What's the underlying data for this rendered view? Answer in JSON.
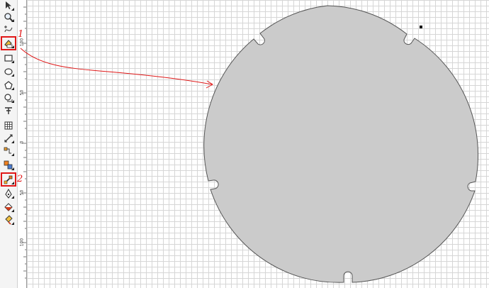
{
  "toolbox": {
    "tools": [
      {
        "name": "pick-tool",
        "icon": "pointer-icon"
      },
      {
        "name": "zoom-tool",
        "icon": "magnifier-icon"
      },
      {
        "name": "freehand-tool",
        "icon": "freehand-icon"
      },
      {
        "name": "smart-fill-tool",
        "icon": "smart-fill-icon"
      },
      {
        "name": "rectangle-tool",
        "icon": "rectangle-icon"
      },
      {
        "name": "ellipse-tool",
        "icon": "ellipse-icon"
      },
      {
        "name": "polygon-tool",
        "icon": "polygon-icon"
      },
      {
        "name": "basic-shapes-tool",
        "icon": "basic-shapes-icon"
      },
      {
        "name": "text-tool",
        "icon": "text-icon"
      },
      {
        "name": "table-tool",
        "icon": "table-icon"
      },
      {
        "name": "dimension-tool",
        "icon": "dimension-icon"
      },
      {
        "name": "connector-tool",
        "icon": "connector-icon"
      },
      {
        "name": "blend-tool",
        "icon": "blend-icon"
      },
      {
        "name": "eyedropper-tool",
        "icon": "eyedropper-icon"
      },
      {
        "name": "outline-pen-tool",
        "icon": "outline-pen-icon"
      },
      {
        "name": "fill-tool",
        "icon": "fill-icon"
      },
      {
        "name": "interactive-fill-tool",
        "icon": "interactive-fill-icon"
      }
    ]
  },
  "ruler": {
    "labels": [
      "100",
      "50",
      "0",
      "50",
      "100"
    ]
  },
  "annotations": {
    "marker_1": "1",
    "marker_2": "2",
    "accent_color": "#e01818"
  },
  "shape": {
    "type": "notched-circle",
    "fill": "#cbcbcb",
    "stroke": "#555555"
  }
}
